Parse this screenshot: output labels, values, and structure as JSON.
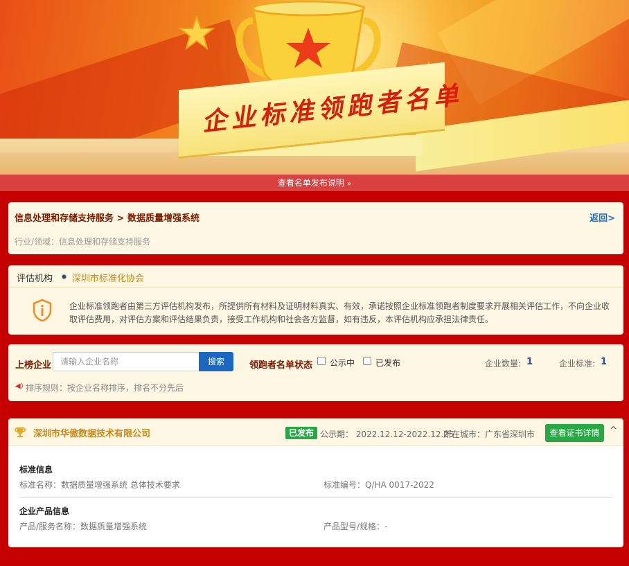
{
  "banner": {
    "title": "企业标准领跑者名单"
  },
  "notice": {
    "label": "查看名单发布说明",
    "chevron": "»"
  },
  "breadcrumb": {
    "path": "信息处理和存储支持服务 > 数据质量增强系统",
    "back_label": "返回>",
    "industry_label": "行业/领域：信息处理和存储支持服务"
  },
  "agency": {
    "label": "评估机构",
    "name": "深圳市标准化协会",
    "icon": "info-shield-icon",
    "description": "企业标准领跑者由第三方评估机构发布，所提供所有材料及证明材料真实、有效，承诺按照企业标准领跑者制度要求开展相关评估工作，不向企业收取评估费用，对评估方案和评估结果负责，接受工作机构和社会各方监督，如有违反，本评估机构应承担法律责任。"
  },
  "search": {
    "label": "上榜企业",
    "placeholder": "请输入企业名称",
    "button_label": "搜索",
    "status_label": "领跑者名单状态",
    "options": [
      {
        "label": "公示中",
        "checked": false
      },
      {
        "label": "已发布",
        "checked": false
      }
    ],
    "company_count_label": "企业数量:",
    "company_count": "1",
    "standard_count_label": "企业标准:",
    "standard_count": "1",
    "sort_rule": "排序规则：按企业名称排序，排名不分先后"
  },
  "company": {
    "name": "深圳市华傲数据技术有限公司",
    "status_badge": "已发布",
    "period": "公示期： 2022.12.12-2022.12.25",
    "city": "所在城市：广东省深圳市",
    "detail_button": "查看证书详情",
    "collapse_icon": "^",
    "standard_section": "标准信息",
    "standard_name": "标准名称：数据质量增强系统 总体技术要求",
    "standard_number": "标准编号：Q/HA 0017-2022",
    "product_section": "企业产品信息",
    "product_name": "产品/服务名称：数据质量增强系统",
    "product_model": "产品型号/规格：-"
  },
  "colors": {
    "page_bg": "#c40000",
    "card_bg": "#fdf6e3",
    "accent_gold": "#c58a1a",
    "dark_red_text": "#7a1b00",
    "primary_blue": "#1a66c2",
    "success_green": "#28a745"
  }
}
